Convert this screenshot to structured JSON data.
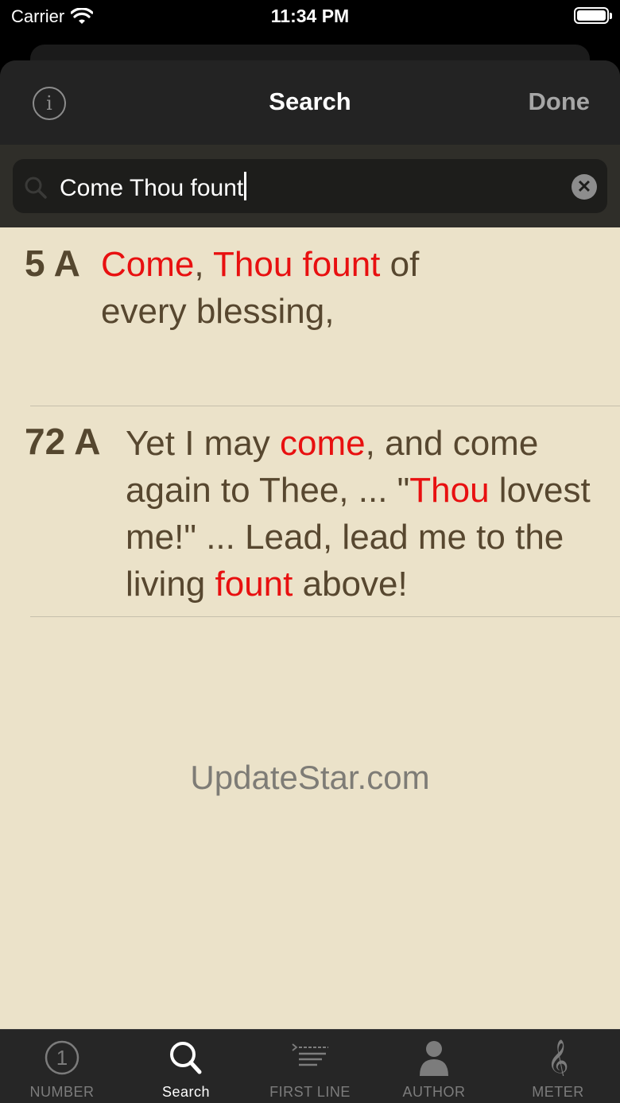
{
  "status_bar": {
    "carrier": "Carrier",
    "time": "11:34 PM"
  },
  "nav": {
    "info_icon": "info-circle-icon",
    "title": "Search",
    "done_label": "Done"
  },
  "search": {
    "value": "Come Thou fount",
    "clear_icon": "clear-circle-icon",
    "search_icon": "magnifier-icon"
  },
  "results": [
    {
      "number": "5 A",
      "segments": [
        {
          "text": "Come",
          "hl": true
        },
        {
          "text": ", ",
          "hl": false
        },
        {
          "text": "Thou fount",
          "hl": true
        },
        {
          "text": " of every blessing,",
          "hl": false
        }
      ]
    },
    {
      "number": "72 A",
      "segments": [
        {
          "text": "Yet I may ",
          "hl": false
        },
        {
          "text": "come",
          "hl": true
        },
        {
          "text": ", and come again to Thee, ... \"",
          "hl": false
        },
        {
          "text": "Thou",
          "hl": true
        },
        {
          "text": " lovest me!\" ... Lead, lead me to the living ",
          "hl": false
        },
        {
          "text": "fount",
          "hl": true
        },
        {
          "text": " above!",
          "hl": false
        }
      ]
    }
  ],
  "watermark": "UpdateStar.com",
  "tabs": [
    {
      "label": "NUMBER",
      "icon": "number-one-circle-icon",
      "active": false
    },
    {
      "label": "Search",
      "icon": "search-icon",
      "active": true
    },
    {
      "label": "FIRST LINE",
      "icon": "first-line-icon",
      "active": false
    },
    {
      "label": "AUTHOR",
      "icon": "person-icon",
      "active": false
    },
    {
      "label": "METER",
      "icon": "treble-clef-icon",
      "active": false
    }
  ],
  "colors": {
    "highlight": "#e81010",
    "results_background": "#ebe2c9",
    "text_brown": "#57472f"
  }
}
